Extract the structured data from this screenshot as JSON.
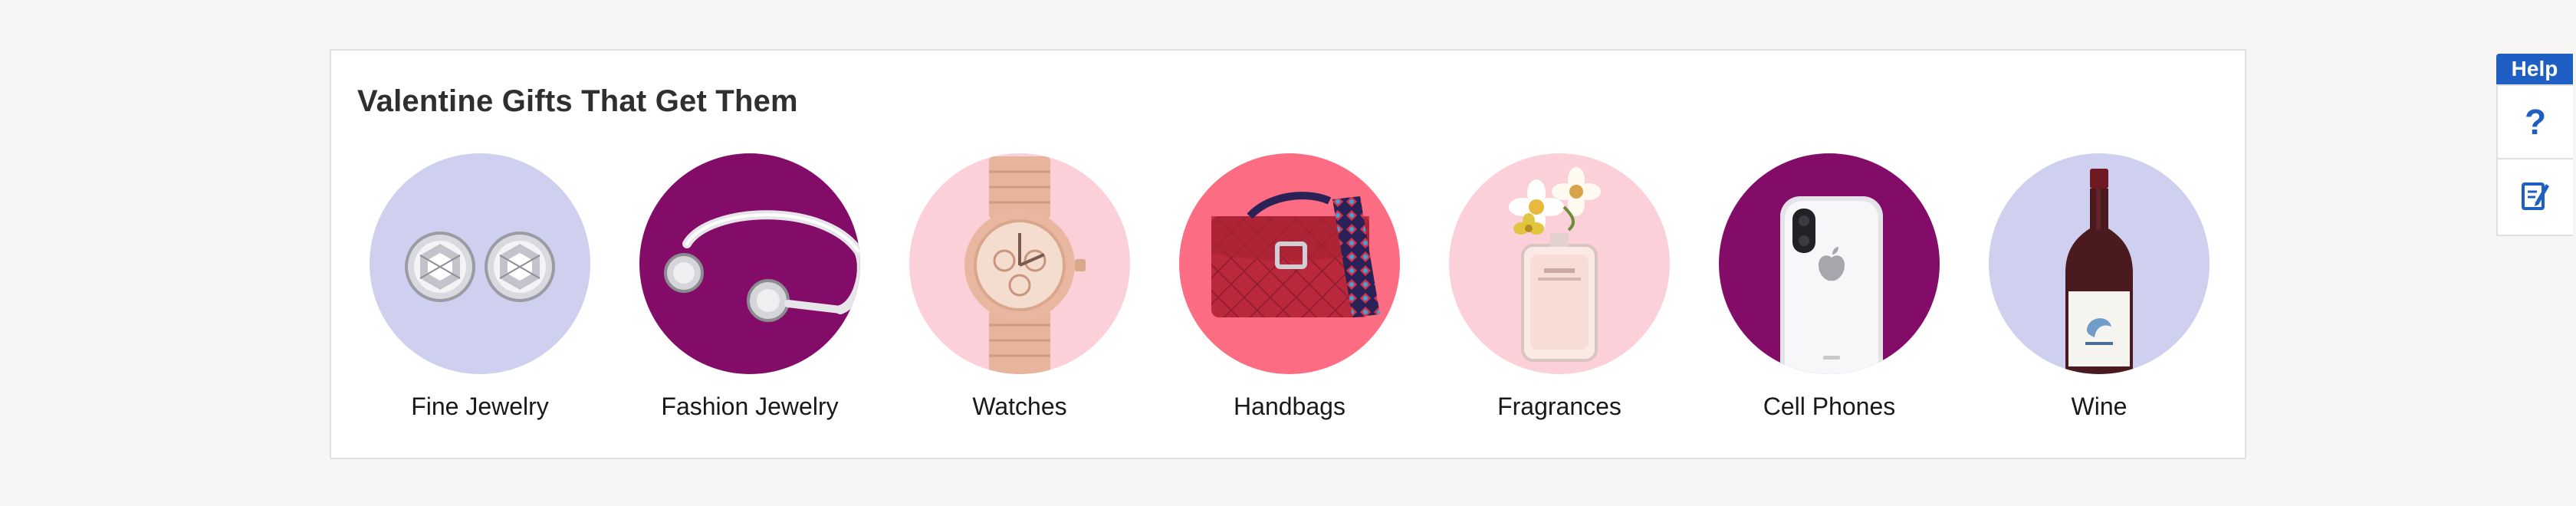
{
  "section": {
    "title": "Valentine Gifts That Get Them",
    "tiles": [
      {
        "label": "Fine Jewelry",
        "bg": "#cfcff0",
        "icon": "earrings-icon"
      },
      {
        "label": "Fashion Jewelry",
        "bg": "#820c68",
        "icon": "bangle-bracelet-icon"
      },
      {
        "label": "Watches",
        "bg": "#fbd0d9",
        "icon": "watch-icon"
      },
      {
        "label": "Handbags",
        "bg": "#fc6d83",
        "icon": "handbag-icon"
      },
      {
        "label": "Fragrances",
        "bg": "#fbd0d9",
        "icon": "perfume-bottle-icon"
      },
      {
        "label": "Cell Phones",
        "bg": "#820c68",
        "icon": "smartphone-icon"
      },
      {
        "label": "Wine",
        "bg": "#cfcff0",
        "icon": "wine-bottle-icon"
      }
    ]
  },
  "help": {
    "tab_label": "Help",
    "question_glyph": "?",
    "accent": "#1f5fc3"
  }
}
